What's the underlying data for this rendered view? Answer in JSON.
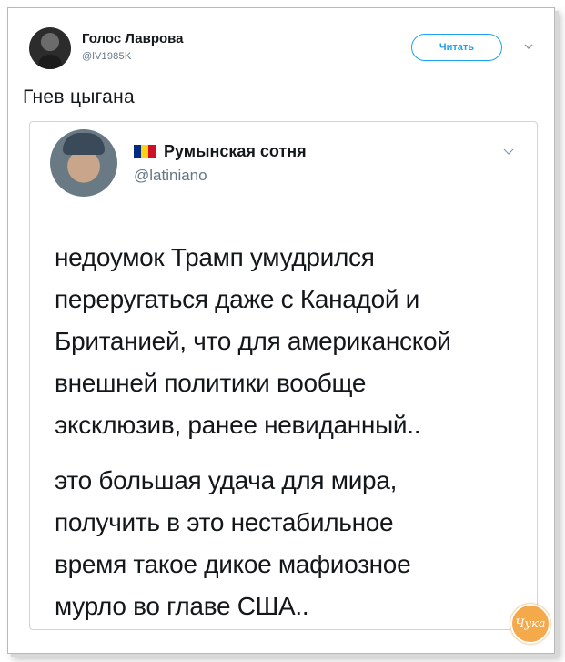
{
  "outer_tweet": {
    "author_name": "Голос Лаврова",
    "author_handle": "@lV1985K",
    "follow_label": "Читать",
    "text": "Гнев цыгана"
  },
  "quoted_tweet": {
    "author_name": "Румынская сотня",
    "author_handle": "@latiniano",
    "flag_colors": [
      "#002b7f",
      "#fcd116",
      "#ce1126"
    ],
    "paragraph_1": [
      "недоумок Трамп умудрился",
      "переругаться даже с Канадой и",
      "Британией, что для американской",
      "внешней политики вообще",
      "эксклюзив, ранее невиданный.."
    ],
    "paragraph_2": [
      "это большая удача для мира,",
      "получить в это нестабильное",
      "время такое дикое мафиозное",
      "мурло во главе США.."
    ]
  },
  "watermark": {
    "text": "Чука"
  },
  "colors": {
    "accent": "#1da1f2",
    "muted": "#657786",
    "border": "#ccd6dd"
  }
}
